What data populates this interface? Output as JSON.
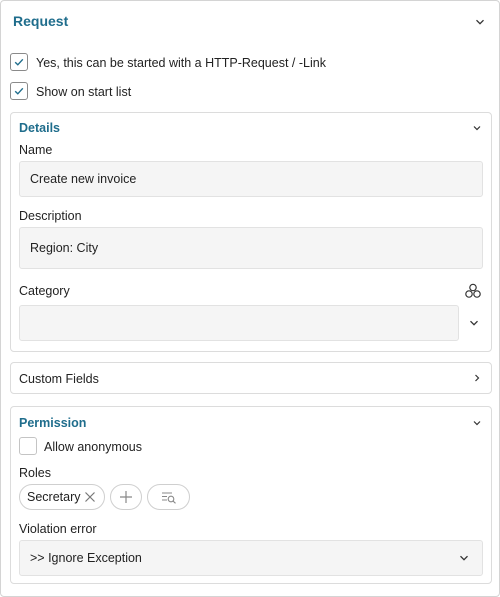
{
  "request_panel": {
    "title": "Request",
    "http_checkbox": {
      "label": "Yes, this can be started with a HTTP-Request / -Link",
      "checked": true
    },
    "startlist_checkbox": {
      "label": "Show on start list",
      "checked": true
    }
  },
  "details": {
    "title": "Details",
    "name_label": "Name",
    "name_value": "Create new invoice",
    "description_label": "Description",
    "description_value": "Region: City",
    "category_label": "Category",
    "category_value": ""
  },
  "custom_fields": {
    "title": "Custom Fields"
  },
  "permission": {
    "title": "Permission",
    "anonymous_checkbox": {
      "label": "Allow anonymous",
      "checked": false
    },
    "roles_label": "Roles",
    "roles": [
      "Secretary"
    ],
    "violation_label": "Violation error",
    "violation_value": ">> Ignore Exception"
  },
  "colors": {
    "accent": "#1f6d8c",
    "field_bg": "#f5f5f5",
    "border": "#dcdcdc"
  },
  "icons": [
    "chevron-down-icon",
    "chevron-right-icon",
    "check-icon",
    "hierarchy-icon",
    "close-icon",
    "plus-icon",
    "search-list-icon"
  ]
}
